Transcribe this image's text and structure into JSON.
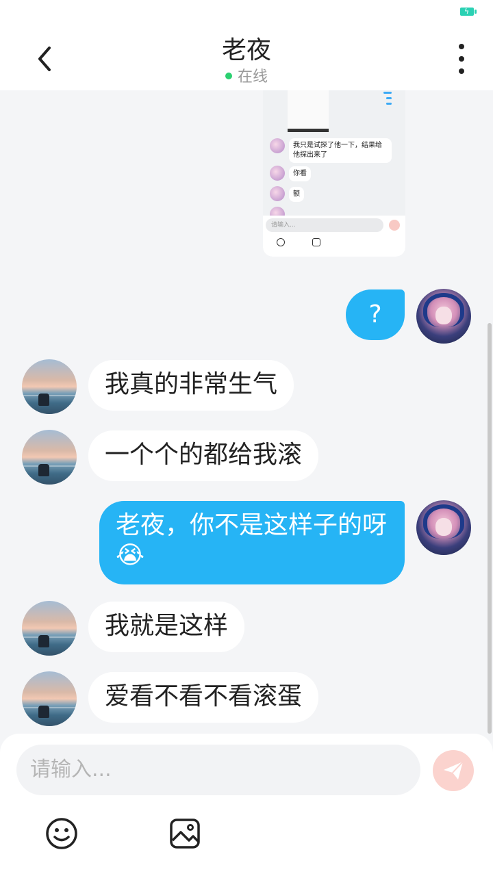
{
  "header": {
    "title": "老夜",
    "status": "在线",
    "online_color": "#2bd070"
  },
  "screenshot_preview": {
    "messages": [
      {
        "text": "我只是试探了他一下，结果给他探出来了"
      },
      {
        "text": "你看"
      },
      {
        "text": "额"
      }
    ],
    "input_placeholder": "请输入..."
  },
  "messages": [
    {
      "side": "out",
      "text": "?"
    },
    {
      "side": "in",
      "text": "我真的非常生气"
    },
    {
      "side": "in",
      "text": "一个个的都给我滚"
    },
    {
      "side": "out",
      "text": "老夜，你不是这样子的呀😭"
    },
    {
      "side": "in",
      "text": "我就是这样"
    },
    {
      "side": "in",
      "text": "爱看不看不看滚蛋"
    }
  ],
  "composer": {
    "placeholder": "请输入...",
    "send_icon": "send-icon",
    "emoji_icon": "emoji-icon",
    "image_icon": "image-icon"
  },
  "colors": {
    "outgoing_bubble": "#26b4f5",
    "incoming_bubble": "#ffffff",
    "background": "#f4f5f7",
    "send_button": "#fbd3ce"
  }
}
